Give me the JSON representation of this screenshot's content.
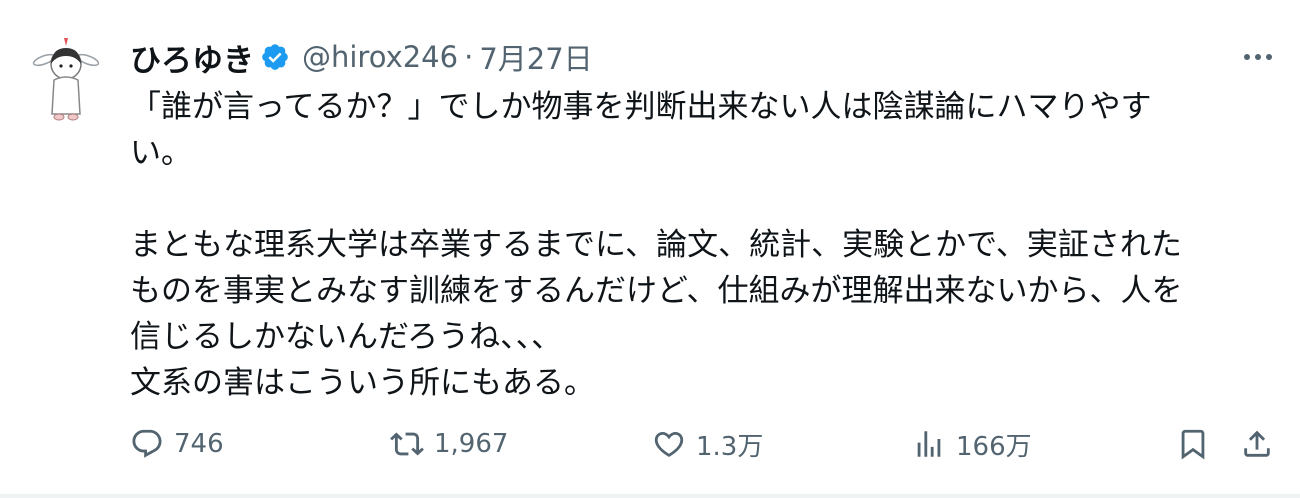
{
  "tweet": {
    "author": {
      "display_name": "ひろゆき",
      "handle": "@hirox246",
      "separator": "·",
      "date": "7月27日",
      "verified_icon": "verified-badge-icon",
      "verified_color": "#1d9bf0"
    },
    "body": {
      "line1": "「誰が言ってるか？」でしか物事を判断出来ない人は陰謀論にハマりやす",
      "line2": "い。",
      "line3": "まともな理系大学は卒業するまでに、論文、統計、実験とかで、実証された",
      "line4": "ものを事実とみなす訓練をするんだけど、仕組みが理解出来ないから、人を",
      "line5": "信じるしかないんだろうね、、、",
      "line6": "文系の害はこういう所にもある。"
    },
    "actions": {
      "reply_count": "746",
      "retweet_count": "1,967",
      "like_count": "1.3万",
      "view_count": "166万"
    },
    "colors": {
      "text": "#0f1419",
      "secondary": "#536471",
      "divider": "#eff3f4"
    }
  }
}
